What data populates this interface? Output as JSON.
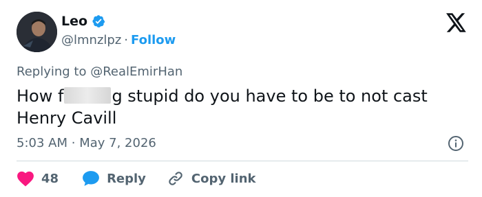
{
  "author": {
    "name": "Leo",
    "handle": "@lmnzlpz",
    "separator": "·",
    "follow_label": "Follow"
  },
  "reply_context": {
    "prefix": "Replying to",
    "mention": "@RealEmirHan"
  },
  "tweet": {
    "text_part1": "How f",
    "text_part2": "g stupid do you have to be to not cast Henry Cavill"
  },
  "meta": {
    "time": "5:03 AM",
    "separator": "·",
    "date": "May 7, 2026"
  },
  "actions": {
    "like_count": "48",
    "reply_label": "Reply",
    "copy_label": "Copy link"
  },
  "colors": {
    "accent": "#1d9bf0",
    "like": "#f91880",
    "muted": "#536471",
    "text": "#0f1419"
  },
  "icons": [
    "verified-badge-icon",
    "x-logo-icon",
    "info-icon",
    "heart-icon",
    "speech-bubble-icon",
    "link-icon"
  ]
}
